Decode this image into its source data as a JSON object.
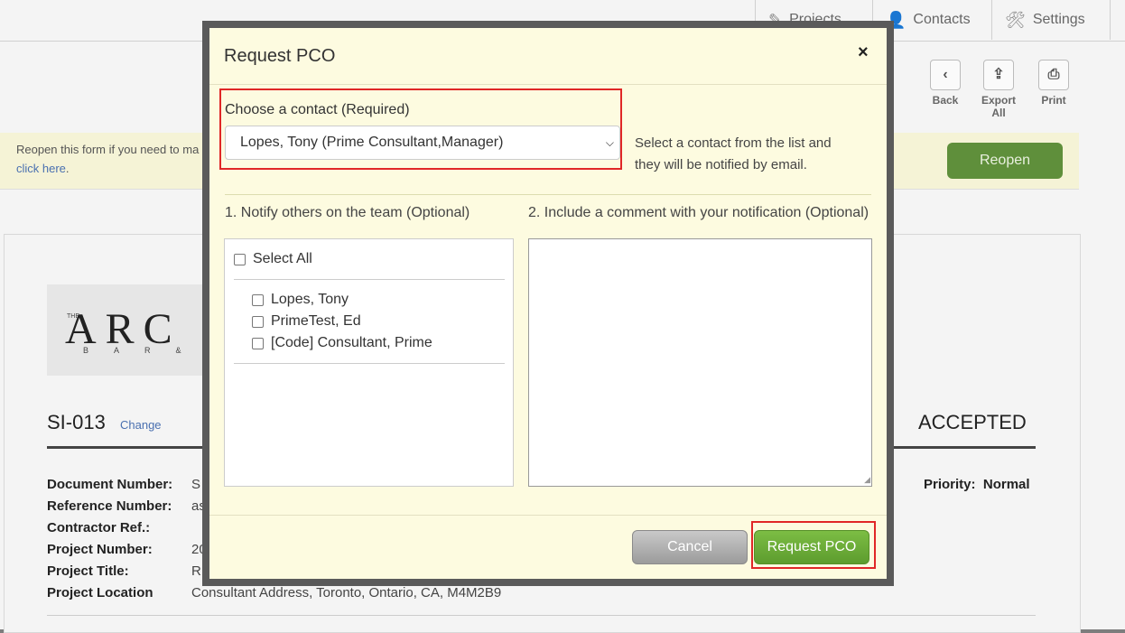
{
  "nav": {
    "projects": "Projects",
    "contacts": "Contacts",
    "settings": "Settings"
  },
  "toolbar": {
    "back": "Back",
    "export_all": "Export All",
    "print": "Print"
  },
  "banner": {
    "message": "Reopen this form if you need to ma",
    "link": "click here",
    "link_suffix": ".",
    "reopen_label": "Reopen"
  },
  "document": {
    "logo_text": "ARC",
    "logo_the": "THE",
    "logo_sub": "BAR&",
    "number": "SI-013",
    "change_label": "Change",
    "status": "ACCEPTED",
    "priority_label": "Priority:",
    "priority_value": "Normal",
    "fields": [
      {
        "label": "Document Number:",
        "value": "S"
      },
      {
        "label": "Reference Number:",
        "value": "as"
      },
      {
        "label": "Contractor Ref.:",
        "value": ""
      },
      {
        "label": "Project Number:",
        "value": "20"
      },
      {
        "label": "Project Title:",
        "value": "R"
      },
      {
        "label": "Project Location",
        "value": "Consultant Address, Toronto, Ontario, CA, M4M2B9"
      }
    ]
  },
  "modal": {
    "title": "Request PCO",
    "close": "×",
    "contact_label": "Choose a contact (Required)",
    "contact_selected": "Lopes, Tony (Prime Consultant,Manager)",
    "contact_hint": "Select a contact from the list and they will be notified by email.",
    "notify_label": "1. Notify others on the team (Optional)",
    "comment_label": "2. Include a comment with your notification (Optional)",
    "select_all": "Select All",
    "team": [
      "Lopes, Tony",
      "PrimeTest, Ed",
      "[Code] Consultant, Prime"
    ],
    "cancel_label": "Cancel",
    "request_label": "Request PCO"
  }
}
